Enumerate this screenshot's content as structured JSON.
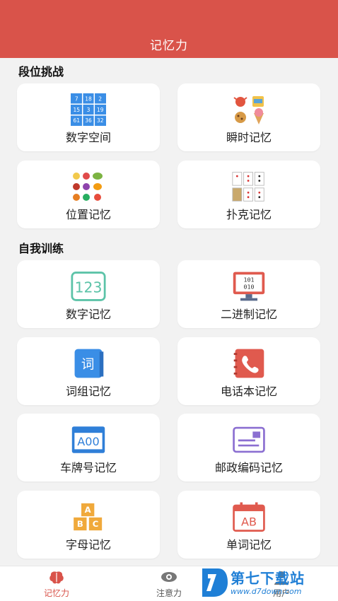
{
  "header": {
    "title": "记忆力"
  },
  "sections": {
    "rank": "段位挑战",
    "self": "自我训练"
  },
  "cards": {
    "number_space": {
      "label": "数字空间",
      "icon": "number-grid-icon",
      "grid": [
        "7",
        "18",
        "2",
        "15",
        "3",
        "19",
        "61",
        "36",
        "32"
      ]
    },
    "instant": {
      "label": "瞬时记忆",
      "icon": "food-items-icon"
    },
    "position": {
      "label": "位置记忆",
      "icon": "fruits-icon"
    },
    "poker": {
      "label": "扑克记忆",
      "icon": "playing-cards-icon"
    },
    "number_memory": {
      "label": "数字记忆",
      "icon": "digits-123-icon",
      "icon_text": "123"
    },
    "binary": {
      "label": "二进制记忆",
      "icon": "binary-monitor-icon",
      "icon_text_1": "101",
      "icon_text_2": "010"
    },
    "phrase": {
      "label": "词组记忆",
      "icon": "book-ci-icon",
      "icon_text": "词"
    },
    "phonebook": {
      "label": "电话本记忆",
      "icon": "phone-book-icon"
    },
    "plate": {
      "label": "车牌号记忆",
      "icon": "license-plate-icon",
      "icon_text": "A00"
    },
    "postcode": {
      "label": "邮政编码记忆",
      "icon": "envelope-icon"
    },
    "letters": {
      "label": "字母记忆",
      "icon": "alphabet-blocks-icon",
      "b1": "A",
      "b2": "B",
      "b3": "C"
    },
    "words": {
      "label": "单词记忆",
      "icon": "calendar-ab-icon",
      "icon_text": "AB"
    }
  },
  "tabs": [
    {
      "label": "记忆力",
      "icon": "brain-icon",
      "active": true
    },
    {
      "label": "注意力",
      "icon": "eye-icon",
      "active": false
    },
    {
      "label": "用户",
      "icon": "user-icon",
      "active": false
    }
  ],
  "watermark": {
    "text": "第七下载站",
    "url": "www.d7down.com"
  },
  "colors": {
    "header": "#d9534a",
    "active_tab": "#d9534a",
    "grid_blue": "#3a8ee6",
    "teal": "#5cc3a8",
    "red_icon": "#e05a4e",
    "purple": "#8b6fd1",
    "orange": "#f0a93b"
  }
}
